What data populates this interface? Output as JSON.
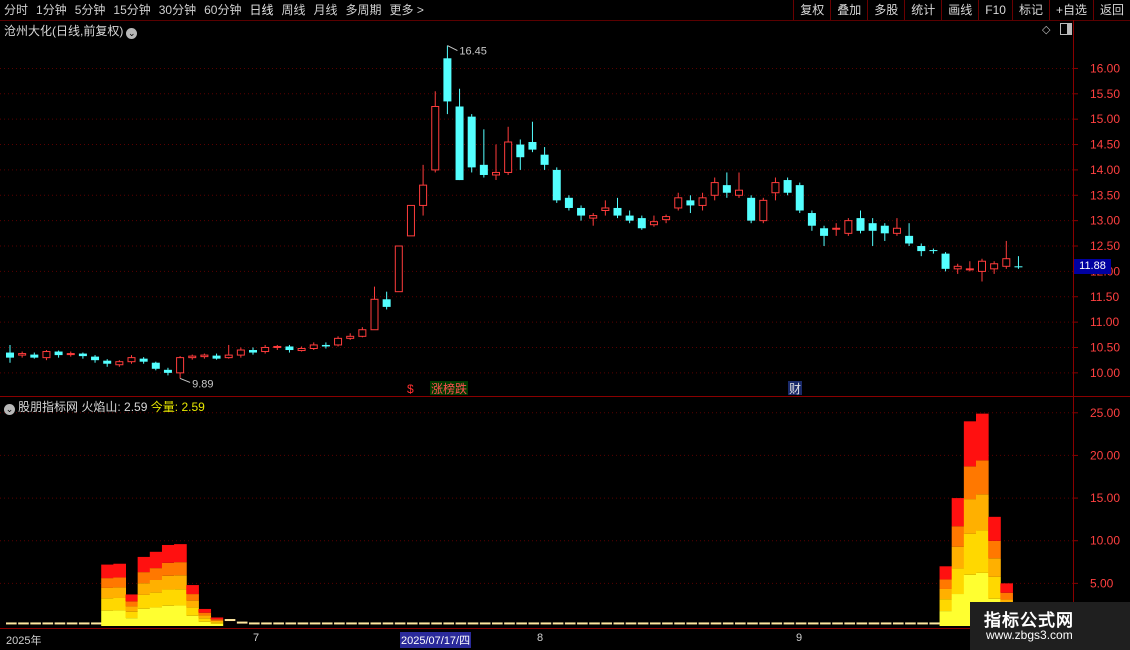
{
  "toolbar": {
    "periods": [
      "分时",
      "1分钟",
      "5分钟",
      "15分钟",
      "30分钟",
      "60分钟",
      "日线",
      "周线",
      "月线",
      "多周期",
      "更多 >"
    ],
    "active_period": "日线",
    "right_buttons": [
      "复权",
      "叠加",
      "多股",
      "统计",
      "画线",
      "F10",
      "标记",
      "+自选",
      "返回"
    ]
  },
  "main_panel": {
    "title": "沧州大化(日线,前复权)",
    "high_label": "16.45",
    "low_label": "9.89",
    "last_price": "11.88",
    "events": [
      "$",
      "涨榜跌",
      "财"
    ],
    "y_ticks": [
      "16.00",
      "15.50",
      "15.00",
      "14.50",
      "14.00",
      "13.50",
      "13.00",
      "12.50",
      "12.00",
      "11.50",
      "11.00",
      "10.50",
      "10.00"
    ]
  },
  "indicator_panel": {
    "source": "股朋指标网",
    "name1": "火焰山:",
    "val1": "2.59",
    "name2": "今量:",
    "val2": "2.59",
    "y_ticks": [
      "25.00",
      "20.00",
      "15.00",
      "10.00",
      "5.00"
    ]
  },
  "date_axis": {
    "labels": [
      "2025年",
      "7",
      "2025/07/17/四",
      "8",
      "9"
    ]
  },
  "watermark": {
    "line1": "指标公式网",
    "line2": "www.zbgs3.com"
  },
  "colors": {
    "up": "#ff3c3c",
    "down": "#54ffff",
    "bg": "#000000",
    "grid": "#5a0000"
  },
  "chart_data": {
    "type": "candlestick",
    "ylim": [
      9.8,
      16.6
    ],
    "candles": [
      [
        10.4,
        10.3,
        10.55,
        10.2
      ],
      [
        10.35,
        10.38,
        10.42,
        10.3
      ],
      [
        10.36,
        10.3,
        10.4,
        10.28
      ],
      [
        10.3,
        10.42,
        10.45,
        10.25
      ],
      [
        10.42,
        10.35,
        10.44,
        10.3
      ],
      [
        10.36,
        10.38,
        10.42,
        10.32
      ],
      [
        10.38,
        10.33,
        10.4,
        10.28
      ],
      [
        10.32,
        10.25,
        10.35,
        10.2
      ],
      [
        10.24,
        10.18,
        10.27,
        10.12
      ],
      [
        10.16,
        10.22,
        10.25,
        10.12
      ],
      [
        10.22,
        10.3,
        10.35,
        10.18
      ],
      [
        10.28,
        10.22,
        10.31,
        10.18
      ],
      [
        10.2,
        10.08,
        10.22,
        10.05
      ],
      [
        10.06,
        10.0,
        10.1,
        9.95
      ],
      [
        10.0,
        10.3,
        10.33,
        9.89
      ],
      [
        10.3,
        10.33,
        10.36,
        10.26
      ],
      [
        10.32,
        10.35,
        10.38,
        10.28
      ],
      [
        10.34,
        10.28,
        10.38,
        10.26
      ],
      [
        10.3,
        10.35,
        10.55,
        10.28
      ],
      [
        10.35,
        10.45,
        10.5,
        10.3
      ],
      [
        10.45,
        10.4,
        10.5,
        10.36
      ],
      [
        10.42,
        10.5,
        10.55,
        10.38
      ],
      [
        10.5,
        10.52,
        10.55,
        10.45
      ],
      [
        10.52,
        10.45,
        10.55,
        10.4
      ],
      [
        10.44,
        10.48,
        10.52,
        10.42
      ],
      [
        10.48,
        10.55,
        10.6,
        10.45
      ],
      [
        10.55,
        10.52,
        10.6,
        10.48
      ],
      [
        10.55,
        10.68,
        10.72,
        10.52
      ],
      [
        10.68,
        10.72,
        10.78,
        10.65
      ],
      [
        10.72,
        10.85,
        10.9,
        10.7
      ],
      [
        10.85,
        11.45,
        11.7,
        10.85
      ],
      [
        11.45,
        11.3,
        11.6,
        11.25
      ],
      [
        11.6,
        12.5,
        12.5,
        11.6
      ],
      [
        12.7,
        13.3,
        13.3,
        12.7
      ],
      [
        13.3,
        13.7,
        14.1,
        13.1
      ],
      [
        14.0,
        15.25,
        15.55,
        13.95
      ],
      [
        16.2,
        15.35,
        16.45,
        15.1
      ],
      [
        15.25,
        13.8,
        15.6,
        13.8
      ],
      [
        15.05,
        14.05,
        15.1,
        13.95
      ],
      [
        14.1,
        13.9,
        14.8,
        13.85
      ],
      [
        13.9,
        13.95,
        14.5,
        13.8
      ],
      [
        13.95,
        14.55,
        14.85,
        13.9
      ],
      [
        14.5,
        14.25,
        14.6,
        14.0
      ],
      [
        14.55,
        14.4,
        14.95,
        14.35
      ],
      [
        14.3,
        14.1,
        14.45,
        14.0
      ],
      [
        14.0,
        13.4,
        14.05,
        13.35
      ],
      [
        13.45,
        13.25,
        13.5,
        13.2
      ],
      [
        13.25,
        13.1,
        13.3,
        13.0
      ],
      [
        13.05,
        13.1,
        13.15,
        12.9
      ],
      [
        13.2,
        13.25,
        13.4,
        13.1
      ],
      [
        13.25,
        13.1,
        13.45,
        13.05
      ],
      [
        13.1,
        13.0,
        13.2,
        12.95
      ],
      [
        13.05,
        12.85,
        13.1,
        12.82
      ],
      [
        12.92,
        12.98,
        13.1,
        12.88
      ],
      [
        13.02,
        13.08,
        13.12,
        12.95
      ],
      [
        13.25,
        13.45,
        13.55,
        13.2
      ],
      [
        13.4,
        13.3,
        13.5,
        13.15
      ],
      [
        13.3,
        13.45,
        13.55,
        13.2
      ],
      [
        13.5,
        13.75,
        13.85,
        13.4
      ],
      [
        13.7,
        13.55,
        13.95,
        13.45
      ],
      [
        13.5,
        13.6,
        13.95,
        13.45
      ],
      [
        13.45,
        13.0,
        13.5,
        12.95
      ],
      [
        13.0,
        13.4,
        13.45,
        12.95
      ],
      [
        13.55,
        13.75,
        13.85,
        13.4
      ],
      [
        13.8,
        13.55,
        13.85,
        13.5
      ],
      [
        13.7,
        13.2,
        13.75,
        13.15
      ],
      [
        13.15,
        12.9,
        13.2,
        12.8
      ],
      [
        12.85,
        12.7,
        12.9,
        12.5
      ],
      [
        12.85,
        12.85,
        12.95,
        12.7
      ],
      [
        12.75,
        13.0,
        13.05,
        12.7
      ],
      [
        13.05,
        12.8,
        13.2,
        12.75
      ],
      [
        12.95,
        12.8,
        13.05,
        12.5
      ],
      [
        12.9,
        12.75,
        12.95,
        12.6
      ],
      [
        12.75,
        12.85,
        13.05,
        12.7
      ],
      [
        12.7,
        12.55,
        12.95,
        12.5
      ],
      [
        12.5,
        12.4,
        12.55,
        12.3
      ],
      [
        12.42,
        12.4,
        12.45,
        12.35
      ],
      [
        12.35,
        12.05,
        12.38,
        12.0
      ],
      [
        12.05,
        12.1,
        12.15,
        11.95
      ],
      [
        12.05,
        12.05,
        12.2,
        12.0
      ],
      [
        12.0,
        12.2,
        12.25,
        11.8
      ],
      [
        12.05,
        12.15,
        12.2,
        11.95
      ],
      [
        12.1,
        12.25,
        12.6,
        12.05
      ],
      [
        12.1,
        12.08,
        12.3,
        12.05
      ]
    ],
    "indicator": {
      "series_note": "火焰山 stacked bars",
      "values": [
        0.3,
        0.3,
        0.3,
        0.3,
        0.3,
        0.3,
        0.3,
        0.3,
        7.2,
        7.3,
        3.7,
        8.1,
        8.7,
        9.5,
        9.6,
        4.8,
        2.0,
        1.0,
        0.7,
        0.4,
        0.3,
        0.3,
        0.3,
        0.3,
        0.3,
        0.3,
        0.3,
        0.3,
        0.3,
        0.3,
        0.3,
        0.3,
        0.3,
        0.3,
        0.3,
        0.3,
        0.3,
        0.3,
        0.3,
        0.3,
        0.3,
        0.3,
        0.3,
        0.3,
        0.3,
        0.3,
        0.3,
        0.3,
        0.3,
        0.3,
        0.3,
        0.3,
        0.3,
        0.3,
        0.3,
        0.3,
        0.3,
        0.3,
        0.3,
        0.3,
        0.3,
        0.3,
        0.3,
        0.3,
        0.3,
        0.3,
        0.3,
        0.3,
        0.3,
        0.3,
        0.3,
        0.3,
        0.3,
        0.3,
        0.3,
        0.3,
        0.3,
        7.0,
        15.0,
        24.0,
        24.9,
        12.8,
        5.0,
        2.59
      ],
      "ylim": [
        0,
        26.5
      ]
    }
  }
}
